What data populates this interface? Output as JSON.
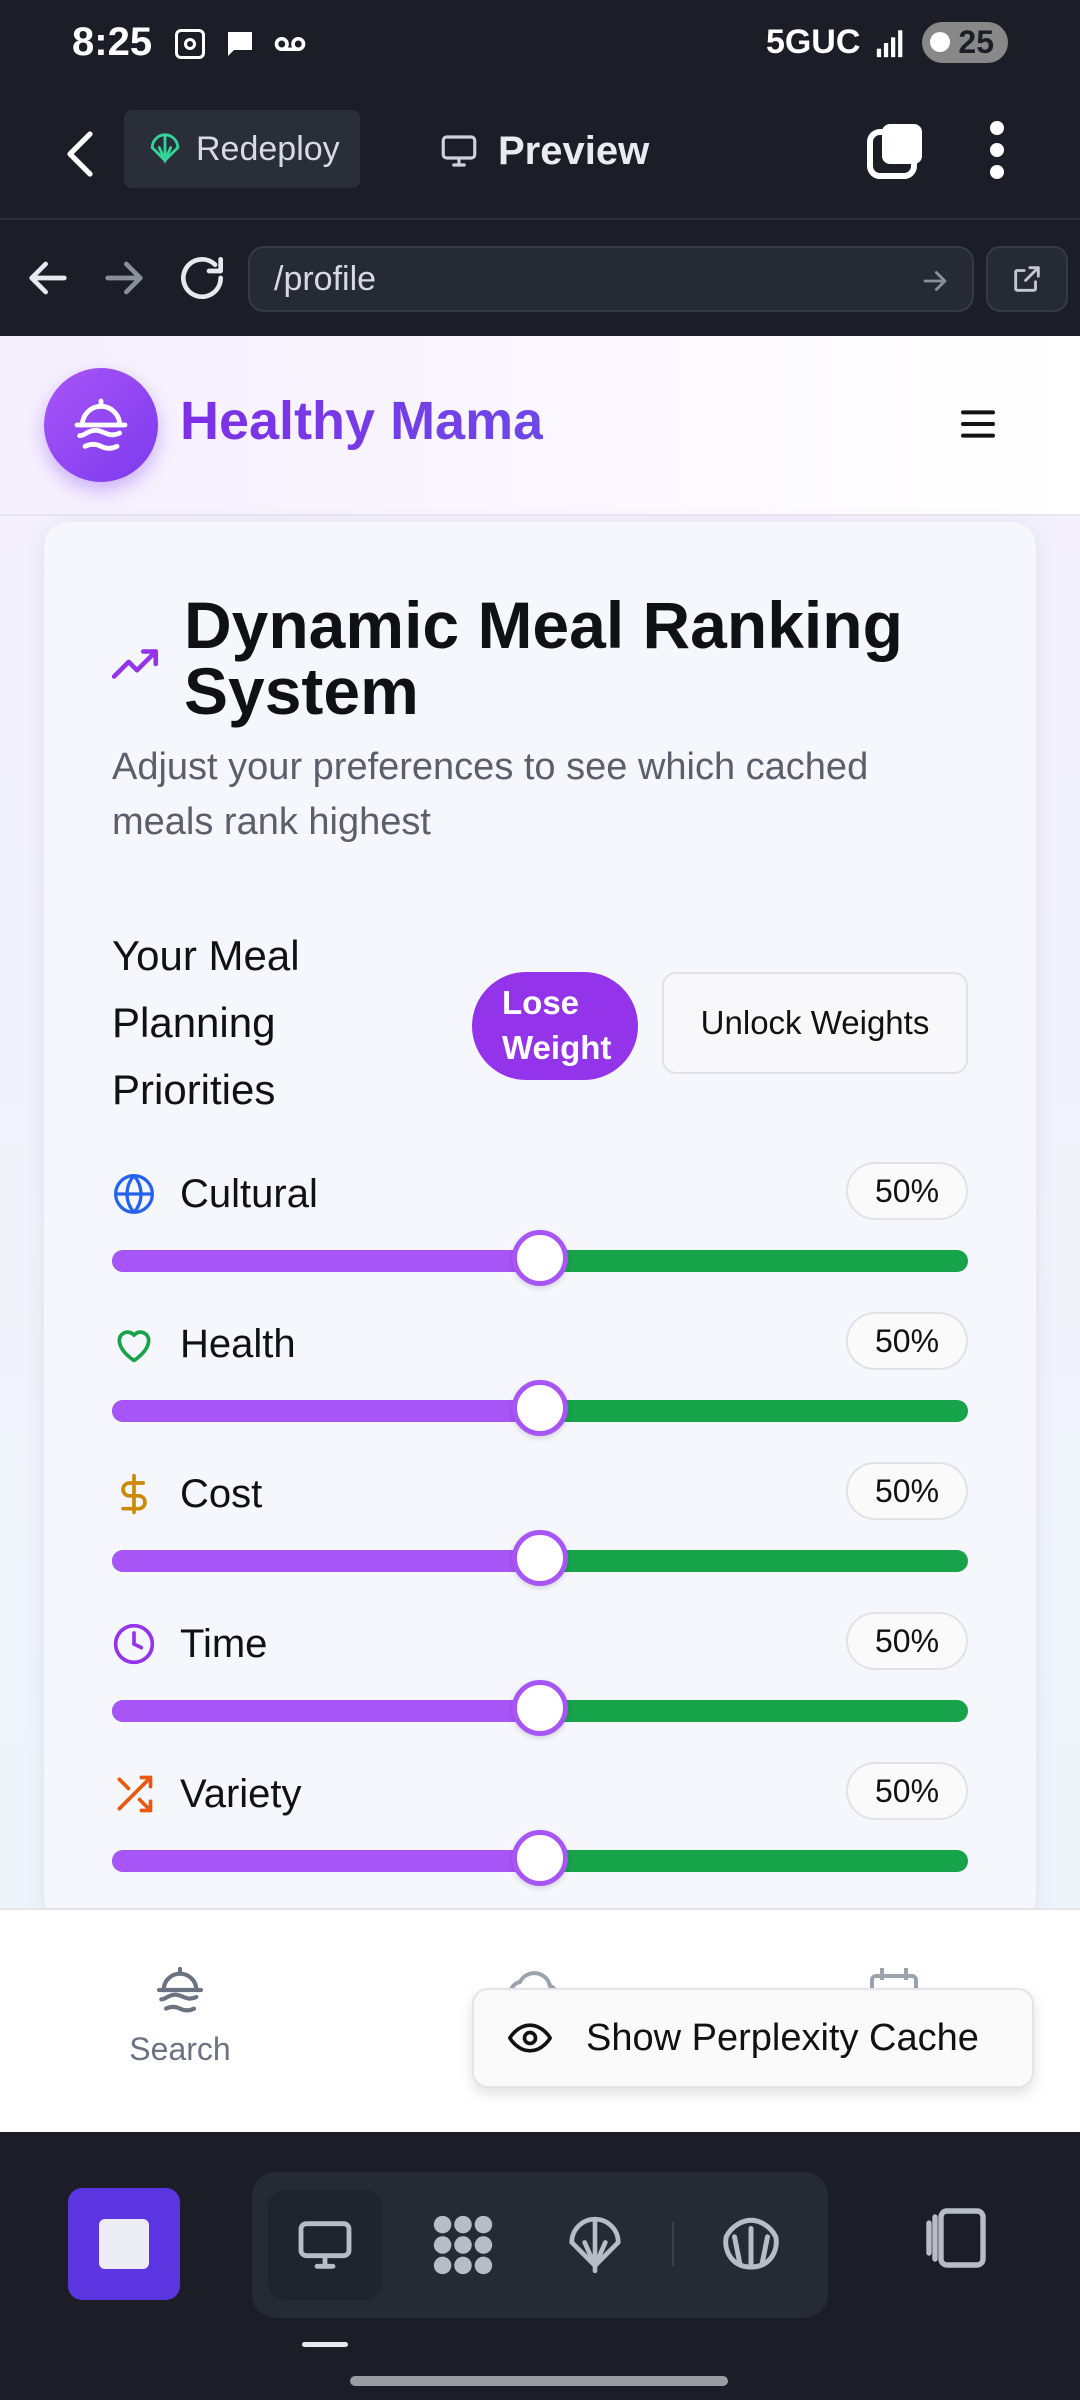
{
  "status_bar": {
    "time": "8:25",
    "network": "5GUC",
    "battery": "25"
  },
  "toolbar": {
    "redeploy_label": "Redeploy",
    "preview_label": "Preview"
  },
  "url_bar": {
    "url": "/profile"
  },
  "site": {
    "brand": "Healthy Mama"
  },
  "card": {
    "title": "Dynamic Meal Ranking System",
    "subtitle": "Adjust your preferences to see which cached meals rank highest",
    "priorities_title": "Your Meal Planning Priorities",
    "lose_weight_label": "Lose Weight",
    "unlock_label": "Unlock Weights"
  },
  "sliders": [
    {
      "label": "Cultural",
      "percent_text": "50%",
      "value": 0.5,
      "icon": "globe-icon",
      "icon_color": "#2563eb"
    },
    {
      "label": "Health",
      "percent_text": "50%",
      "value": 0.5,
      "icon": "heart-icon",
      "icon_color": "#16a34a"
    },
    {
      "label": "Cost",
      "percent_text": "50%",
      "value": 0.5,
      "icon": "dollar-icon",
      "icon_color": "#ca8a04"
    },
    {
      "label": "Time",
      "percent_text": "50%",
      "value": 0.5,
      "icon": "clock-icon",
      "icon_color": "#9333ea"
    },
    {
      "label": "Variety",
      "percent_text": "50%",
      "value": 0.5,
      "icon": "shuffle-icon",
      "icon_color": "#ea580c"
    }
  ],
  "colors": {
    "accent_purple": "#a855f7",
    "track_green": "#16a34a",
    "brand_purple": "#7e2fe6",
    "dock_purple": "#5b35e0"
  },
  "site_nav": {
    "search_label": "Search",
    "cache_label": "Show Perplexity Cache"
  }
}
